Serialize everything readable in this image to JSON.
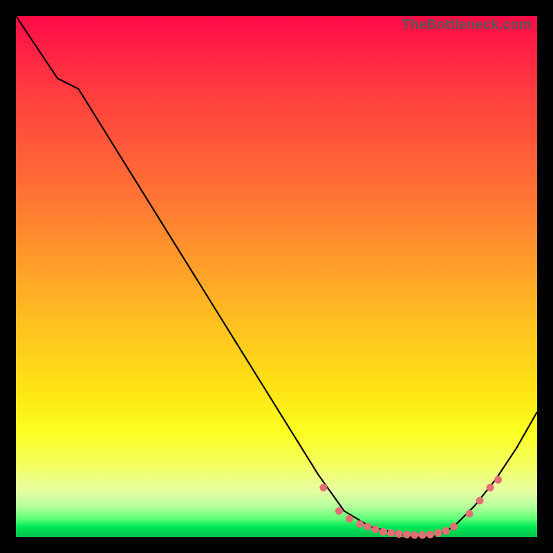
{
  "watermark": "TheBottleneck.com",
  "chart_data": {
    "type": "line",
    "title": "",
    "xlabel": "",
    "ylabel": "",
    "xlim": [
      0,
      100
    ],
    "ylim": [
      0,
      100
    ],
    "series": [
      {
        "name": "bottleneck-curve",
        "x": [
          0,
          8,
          12,
          58,
          63,
          68,
          72,
          76,
          80,
          84,
          88,
          92,
          96,
          100
        ],
        "values": [
          100,
          88,
          86,
          12,
          5,
          2,
          1,
          0,
          0,
          2,
          6,
          11,
          17,
          24
        ]
      }
    ],
    "markers": {
      "name": "highlight-points",
      "color": "#e36f75",
      "x": [
        59,
        62,
        64,
        66,
        67.5,
        69,
        70.5,
        72,
        73.5,
        75,
        76.5,
        78,
        79.5,
        81,
        82.5,
        84,
        87,
        89,
        91,
        92.5
      ],
      "values": [
        9.5,
        5,
        3.5,
        2.5,
        2,
        1.5,
        1,
        0.8,
        0.6,
        0.5,
        0.4,
        0.4,
        0.5,
        0.8,
        1.2,
        2,
        4.5,
        7,
        9.5,
        11
      ]
    }
  }
}
